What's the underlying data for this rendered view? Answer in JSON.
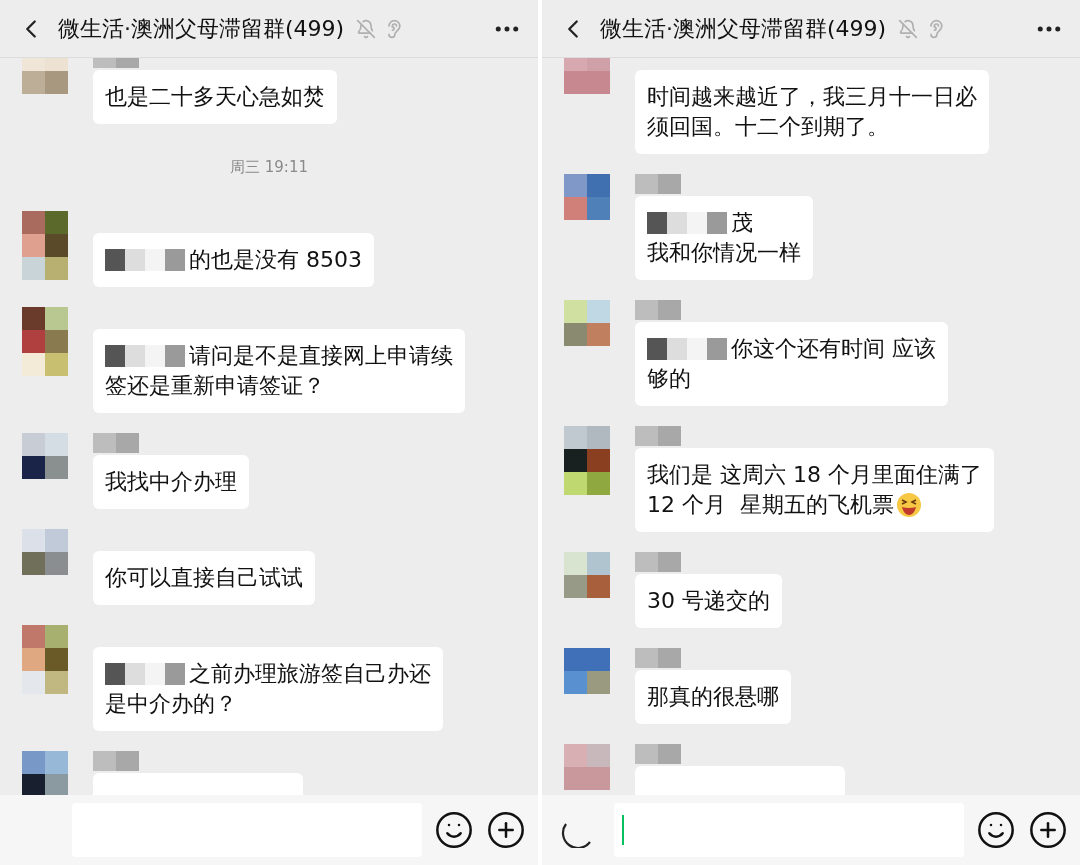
{
  "panels": [
    {
      "header": {
        "title": "微生活·澳洲父母滞留群(499)",
        "muted": true,
        "earpiece": true
      },
      "messages": [
        {
          "kind": "message",
          "name_redacted": true,
          "mention_redacted": false,
          "lines": [
            "也是二十多天心急如焚"
          ],
          "emoji": false
        },
        {
          "kind": "time",
          "text": "周三 19:11"
        },
        {
          "kind": "message",
          "name_redacted": false,
          "mention_redacted": true,
          "lines": [
            "的也是没有 8503"
          ],
          "emoji": false
        },
        {
          "kind": "message",
          "name_redacted": false,
          "mention_redacted": true,
          "lines": [
            "请问是不是直接网上申请续",
            "签还是重新申请签证？"
          ],
          "emoji": false
        },
        {
          "kind": "message",
          "name_redacted": true,
          "mention_redacted": false,
          "lines": [
            "我找中介办理"
          ],
          "emoji": false
        },
        {
          "kind": "message",
          "name_redacted": false,
          "mention_redacted": false,
          "lines": [
            "你可以直接自己试试"
          ],
          "emoji": false
        },
        {
          "kind": "message",
          "name_redacted": false,
          "mention_redacted": true,
          "lines": [
            "之前办理旅游签自己办还",
            "是中介办的？"
          ],
          "emoji": false
        },
        {
          "kind": "cut",
          "name_redacted": true
        }
      ],
      "composer": {
        "voice_button": false,
        "focused": false
      }
    },
    {
      "header": {
        "title": "微生活·澳洲父母滞留群(499)",
        "muted": true,
        "earpiece": true
      },
      "messages": [
        {
          "kind": "message",
          "name_redacted": false,
          "mention_redacted": false,
          "lines": [
            "时间越来越近了，我三月十一日必",
            "须回国。十二个到期了。"
          ],
          "emoji": false
        },
        {
          "kind": "message",
          "name_redacted": true,
          "mention_redacted": true,
          "lines": [
            "茂",
            "我和你情况一样"
          ],
          "emoji": false
        },
        {
          "kind": "message",
          "name_redacted": true,
          "mention_redacted": true,
          "lines": [
            "你这个还有时间 应该",
            "够的"
          ],
          "emoji": false
        },
        {
          "kind": "message",
          "name_redacted": true,
          "mention_redacted": false,
          "lines": [
            "我们是 这周六 18 个月里面住满了",
            "12 个月  星期五的飞机票"
          ],
          "emoji": true
        },
        {
          "kind": "message",
          "name_redacted": true,
          "mention_redacted": false,
          "lines": [
            "30 号递交的"
          ],
          "emoji": false
        },
        {
          "kind": "message",
          "name_redacted": true,
          "mention_redacted": false,
          "lines": [
            "那真的很悬哪"
          ],
          "emoji": false
        },
        {
          "kind": "cut",
          "name_redacted": true
        }
      ],
      "composer": {
        "voice_button": true,
        "focused": true
      }
    }
  ]
}
